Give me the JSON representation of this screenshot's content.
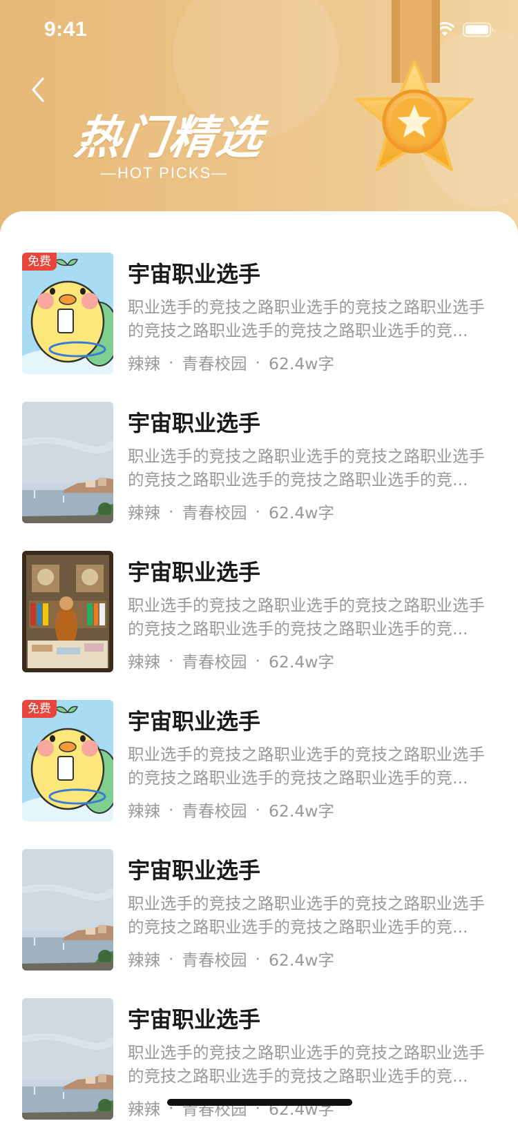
{
  "status_bar": {
    "time": "9:41"
  },
  "header": {
    "title": "热门精选",
    "subtitle": "—HOT PICKS—"
  },
  "books": [
    {
      "title": "宇宙职业选手",
      "description": "职业选手的竞技之路职业选手的竞技之路职业选手的竞技之路职业选手的竞技之路职业选手的竞...",
      "author": "辣辣",
      "category": "青春校园",
      "words": "62.4w字",
      "badge": "免费",
      "cover": "duck"
    },
    {
      "title": "宇宙职业选手",
      "description": "职业选手的竞技之路职业选手的竞技之路职业选手的竞技之路职业选手的竞技之路职业选手的竞...",
      "author": "辣辣",
      "category": "青春校园",
      "words": "62.4w字",
      "badge": "",
      "cover": "seaside"
    },
    {
      "title": "宇宙职业选手",
      "description": "职业选手的竞技之路职业选手的竞技之路职业选手的竞技之路职业选手的竞技之路职业选手的竞...",
      "author": "辣辣",
      "category": "青春校园",
      "words": "62.4w字",
      "badge": "",
      "cover": "bookstore"
    },
    {
      "title": "宇宙职业选手",
      "description": "职业选手的竞技之路职业选手的竞技之路职业选手的竞技之路职业选手的竞技之路职业选手的竞...",
      "author": "辣辣",
      "category": "青春校园",
      "words": "62.4w字",
      "badge": "免费",
      "cover": "duck"
    },
    {
      "title": "宇宙职业选手",
      "description": "职业选手的竞技之路职业选手的竞技之路职业选手的竞技之路职业选手的竞技之路职业选手的竞...",
      "author": "辣辣",
      "category": "青春校园",
      "words": "62.4w字",
      "badge": "",
      "cover": "seaside"
    },
    {
      "title": "宇宙职业选手",
      "description": "职业选手的竞技之路职业选手的竞技之路职业选手的竞技之路职业选手的竞技之路职业选手的竞...",
      "author": "辣辣",
      "category": "青春校园",
      "words": "62.4w字",
      "badge": "",
      "cover": "seaside"
    }
  ],
  "meta_separator": "·",
  "colors": {
    "header_gold": "#ecc387",
    "badge_red": "#e8453c",
    "muted_text": "#999999"
  }
}
